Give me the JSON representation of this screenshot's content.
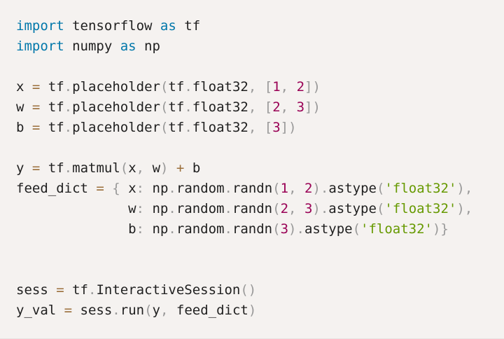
{
  "code": {
    "language": "python",
    "lines": [
      [
        {
          "t": "import",
          "c": "kw"
        },
        {
          "t": " tensorflow ",
          "c": "plain"
        },
        {
          "t": "as",
          "c": "kw"
        },
        {
          "t": " tf",
          "c": "plain"
        }
      ],
      [
        {
          "t": "import",
          "c": "kw"
        },
        {
          "t": " numpy ",
          "c": "plain"
        },
        {
          "t": "as",
          "c": "kw"
        },
        {
          "t": " np",
          "c": "plain"
        }
      ],
      [],
      [
        {
          "t": "x ",
          "c": "plain"
        },
        {
          "t": "=",
          "c": "op"
        },
        {
          "t": " tf",
          "c": "plain"
        },
        {
          "t": ".",
          "c": "punc"
        },
        {
          "t": "placeholder",
          "c": "plain"
        },
        {
          "t": "(",
          "c": "punc"
        },
        {
          "t": "tf",
          "c": "plain"
        },
        {
          "t": ".",
          "c": "punc"
        },
        {
          "t": "float32",
          "c": "plain"
        },
        {
          "t": ",",
          "c": "punc"
        },
        {
          "t": " ",
          "c": "plain"
        },
        {
          "t": "[",
          "c": "punc"
        },
        {
          "t": "1",
          "c": "num"
        },
        {
          "t": ",",
          "c": "punc"
        },
        {
          "t": " ",
          "c": "plain"
        },
        {
          "t": "2",
          "c": "num"
        },
        {
          "t": "])",
          "c": "punc"
        }
      ],
      [
        {
          "t": "w ",
          "c": "plain"
        },
        {
          "t": "=",
          "c": "op"
        },
        {
          "t": " tf",
          "c": "plain"
        },
        {
          "t": ".",
          "c": "punc"
        },
        {
          "t": "placeholder",
          "c": "plain"
        },
        {
          "t": "(",
          "c": "punc"
        },
        {
          "t": "tf",
          "c": "plain"
        },
        {
          "t": ".",
          "c": "punc"
        },
        {
          "t": "float32",
          "c": "plain"
        },
        {
          "t": ",",
          "c": "punc"
        },
        {
          "t": " ",
          "c": "plain"
        },
        {
          "t": "[",
          "c": "punc"
        },
        {
          "t": "2",
          "c": "num"
        },
        {
          "t": ",",
          "c": "punc"
        },
        {
          "t": " ",
          "c": "plain"
        },
        {
          "t": "3",
          "c": "num"
        },
        {
          "t": "])",
          "c": "punc"
        }
      ],
      [
        {
          "t": "b ",
          "c": "plain"
        },
        {
          "t": "=",
          "c": "op"
        },
        {
          "t": " tf",
          "c": "plain"
        },
        {
          "t": ".",
          "c": "punc"
        },
        {
          "t": "placeholder",
          "c": "plain"
        },
        {
          "t": "(",
          "c": "punc"
        },
        {
          "t": "tf",
          "c": "plain"
        },
        {
          "t": ".",
          "c": "punc"
        },
        {
          "t": "float32",
          "c": "plain"
        },
        {
          "t": ",",
          "c": "punc"
        },
        {
          "t": " ",
          "c": "plain"
        },
        {
          "t": "[",
          "c": "punc"
        },
        {
          "t": "3",
          "c": "num"
        },
        {
          "t": "])",
          "c": "punc"
        }
      ],
      [],
      [
        {
          "t": "y ",
          "c": "plain"
        },
        {
          "t": "=",
          "c": "op"
        },
        {
          "t": " tf",
          "c": "plain"
        },
        {
          "t": ".",
          "c": "punc"
        },
        {
          "t": "matmul",
          "c": "plain"
        },
        {
          "t": "(",
          "c": "punc"
        },
        {
          "t": "x",
          "c": "plain"
        },
        {
          "t": ",",
          "c": "punc"
        },
        {
          "t": " w",
          "c": "plain"
        },
        {
          "t": ")",
          "c": "punc"
        },
        {
          "t": " ",
          "c": "plain"
        },
        {
          "t": "+",
          "c": "op"
        },
        {
          "t": " b",
          "c": "plain"
        }
      ],
      [
        {
          "t": "feed_dict ",
          "c": "plain"
        },
        {
          "t": "=",
          "c": "op"
        },
        {
          "t": " ",
          "c": "plain"
        },
        {
          "t": "{",
          "c": "punc"
        },
        {
          "t": " x",
          "c": "plain"
        },
        {
          "t": ":",
          "c": "punc"
        },
        {
          "t": " np",
          "c": "plain"
        },
        {
          "t": ".",
          "c": "punc"
        },
        {
          "t": "random",
          "c": "plain"
        },
        {
          "t": ".",
          "c": "punc"
        },
        {
          "t": "randn",
          "c": "plain"
        },
        {
          "t": "(",
          "c": "punc"
        },
        {
          "t": "1",
          "c": "num"
        },
        {
          "t": ",",
          "c": "punc"
        },
        {
          "t": " ",
          "c": "plain"
        },
        {
          "t": "2",
          "c": "num"
        },
        {
          "t": ")",
          "c": "punc"
        },
        {
          "t": ".",
          "c": "punc"
        },
        {
          "t": "astype",
          "c": "plain"
        },
        {
          "t": "(",
          "c": "punc"
        },
        {
          "t": "'float32'",
          "c": "str"
        },
        {
          "t": "),",
          "c": "punc"
        }
      ],
      [
        {
          "t": "              w",
          "c": "plain"
        },
        {
          "t": ":",
          "c": "punc"
        },
        {
          "t": " np",
          "c": "plain"
        },
        {
          "t": ".",
          "c": "punc"
        },
        {
          "t": "random",
          "c": "plain"
        },
        {
          "t": ".",
          "c": "punc"
        },
        {
          "t": "randn",
          "c": "plain"
        },
        {
          "t": "(",
          "c": "punc"
        },
        {
          "t": "2",
          "c": "num"
        },
        {
          "t": ",",
          "c": "punc"
        },
        {
          "t": " ",
          "c": "plain"
        },
        {
          "t": "3",
          "c": "num"
        },
        {
          "t": ")",
          "c": "punc"
        },
        {
          "t": ".",
          "c": "punc"
        },
        {
          "t": "astype",
          "c": "plain"
        },
        {
          "t": "(",
          "c": "punc"
        },
        {
          "t": "'float32'",
          "c": "str"
        },
        {
          "t": "),",
          "c": "punc"
        }
      ],
      [
        {
          "t": "              b",
          "c": "plain"
        },
        {
          "t": ":",
          "c": "punc"
        },
        {
          "t": " np",
          "c": "plain"
        },
        {
          "t": ".",
          "c": "punc"
        },
        {
          "t": "random",
          "c": "plain"
        },
        {
          "t": ".",
          "c": "punc"
        },
        {
          "t": "randn",
          "c": "plain"
        },
        {
          "t": "(",
          "c": "punc"
        },
        {
          "t": "3",
          "c": "num"
        },
        {
          "t": ")",
          "c": "punc"
        },
        {
          "t": ".",
          "c": "punc"
        },
        {
          "t": "astype",
          "c": "plain"
        },
        {
          "t": "(",
          "c": "punc"
        },
        {
          "t": "'float32'",
          "c": "str"
        },
        {
          "t": ")}",
          "c": "punc"
        }
      ],
      [],
      [],
      [
        {
          "t": "sess ",
          "c": "plain"
        },
        {
          "t": "=",
          "c": "op"
        },
        {
          "t": " tf",
          "c": "plain"
        },
        {
          "t": ".",
          "c": "punc"
        },
        {
          "t": "InteractiveSession",
          "c": "plain"
        },
        {
          "t": "()",
          "c": "punc"
        }
      ],
      [
        {
          "t": "y_val ",
          "c": "plain"
        },
        {
          "t": "=",
          "c": "op"
        },
        {
          "t": " sess",
          "c": "plain"
        },
        {
          "t": ".",
          "c": "punc"
        },
        {
          "t": "run",
          "c": "plain"
        },
        {
          "t": "(",
          "c": "punc"
        },
        {
          "t": "y",
          "c": "plain"
        },
        {
          "t": ",",
          "c": "punc"
        },
        {
          "t": " feed_dict",
          "c": "plain"
        },
        {
          "t": ")",
          "c": "punc"
        }
      ]
    ]
  },
  "colors": {
    "background": "#f5f2f0",
    "keyword": "#0077aa",
    "number": "#990055",
    "string": "#669900",
    "punctuation": "#999999",
    "operator": "#9a6e3a",
    "text": "#1f1f1f"
  }
}
